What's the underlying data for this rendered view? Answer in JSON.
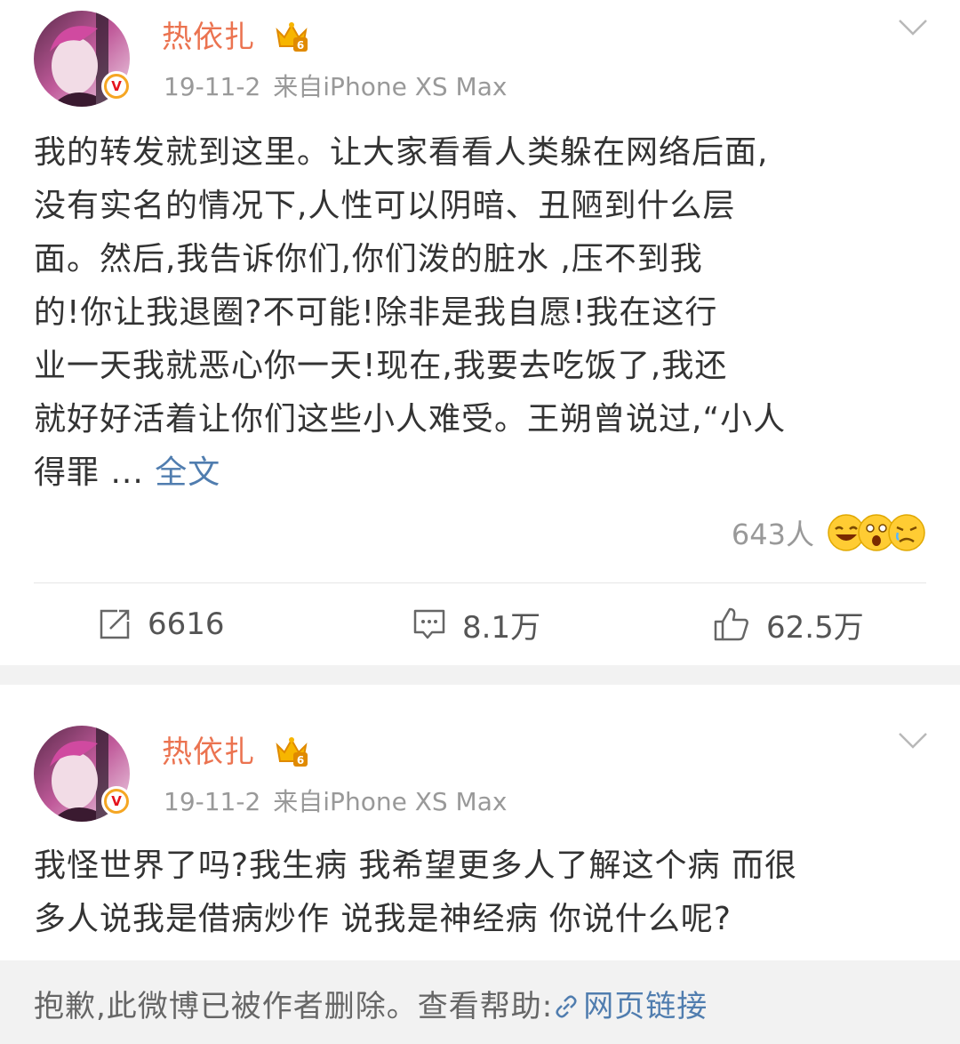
{
  "colors": {
    "username": "#eb7350",
    "link": "#507daf",
    "accent": "#ff8200",
    "muted": "#999999",
    "verified": "#f5a623"
  },
  "post1": {
    "username": "热依扎",
    "date": "19-11-2",
    "source": "来自iPhone XS Max",
    "content_lines": [
      "我的转发就到这里。让大家看看人类躲在网络后面,",
      "没有实名的情况下,人性可以阴暗、丑陋到什么层",
      "面。然后,我告诉你们,你们泼的脏水 ,压不到我",
      "的!你让我退圈?不可能!除非是我自愿!我在这行",
      "业一天我就恶心你一天!现在,我要去吃饭了,我还",
      "就好好活着让你们这些小人难受。王朔曾说过,“小人"
    ],
    "content_tail": "得罪 ... ",
    "full_text_link": "全文",
    "reaction_count": "643人",
    "repost_count": "6616",
    "comment_count": "8.1万",
    "like_count": "62.5万"
  },
  "post2": {
    "username": "热依扎",
    "date": "19-11-2",
    "source": "来自iPhone XS Max",
    "content_lines": [
      "我怪世界了吗?我生病 我希望更多人了解这个病 而很",
      "多人说我是借病炒作 说我是神经病 你说什么呢?"
    ],
    "deleted_notice": "抱歉,此微博已被作者删除。查看帮助:",
    "deleted_link": "网页链接"
  }
}
